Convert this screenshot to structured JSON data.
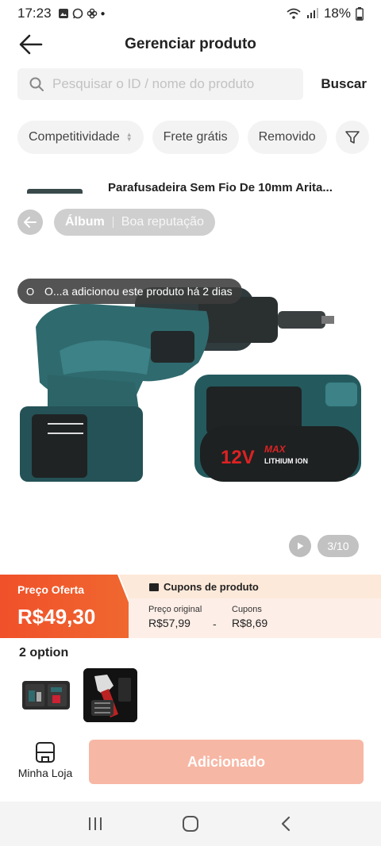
{
  "status": {
    "time": "17:23",
    "battery": "18%"
  },
  "header": {
    "title": "Gerenciar produto"
  },
  "search": {
    "placeholder": "Pesquisar o ID / nome do produto",
    "button": "Buscar"
  },
  "filters": [
    {
      "label": "Competitividade"
    },
    {
      "label": "Frete grátis"
    },
    {
      "label": "Removido"
    }
  ],
  "product": {
    "name": "Parafusadeira Sem Fio De 10mm Arita..."
  },
  "gallery": {
    "tabs": [
      "Álbum",
      "Boa reputação"
    ],
    "toast": "O...a adicionou este produto há 2 dias",
    "toast_icon": "O",
    "counter": "3/10",
    "battery_text_main": "12V",
    "battery_text_max": "MAX",
    "battery_text_sub": "LITHIUM ION"
  },
  "price": {
    "offer_label": "Preço Oferta",
    "offer_value": "R$49,30",
    "coupons_title": "Cupons de produto",
    "original_label": "Preço original",
    "original_value": "R$57,99",
    "separator": "-",
    "coupons_label": "Cupons",
    "coupons_value": "R$8,69"
  },
  "options": {
    "title": "2 option"
  },
  "bottom": {
    "shop_label": "Minha Loja",
    "add_label": "Adicionado"
  },
  "colors": {
    "accent": "#f05a2a",
    "add_disabled": "#f7b7a5",
    "drill_body": "#2f6a6e"
  }
}
